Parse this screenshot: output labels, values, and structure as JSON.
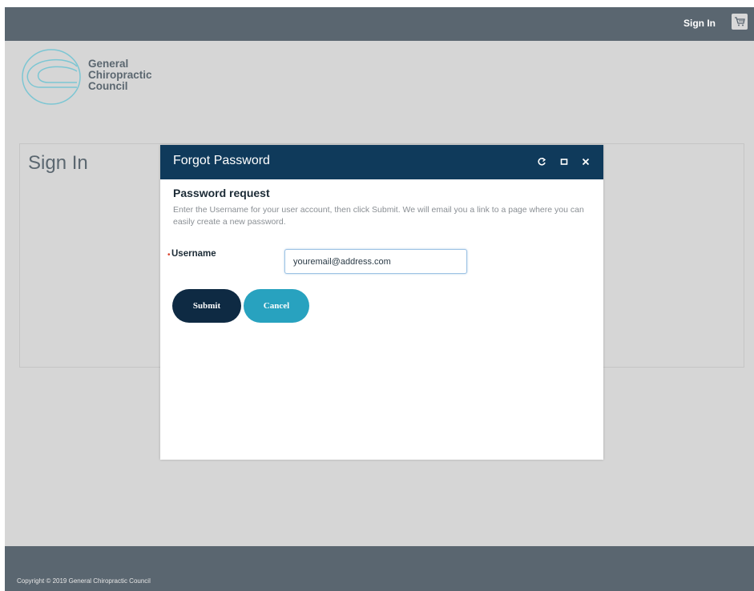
{
  "header": {
    "signin_label": "Sign In",
    "cart_icon": "cart-icon"
  },
  "logo": {
    "line1": "General",
    "line2": "Chiropractic",
    "line3": "Council"
  },
  "page": {
    "title": "Sign In"
  },
  "modal": {
    "title": "Forgot Password",
    "heading": "Password request",
    "description": "Enter the Username for your user account, then click Submit. We will email you a link to a page where you can easily create a new password.",
    "required_mark": "•",
    "username_label": "Username",
    "username_value": "youremail@address.com",
    "submit_label": "Submit",
    "cancel_label": "Cancel",
    "icons": [
      "refresh-icon",
      "maximize-icon",
      "close-icon"
    ]
  },
  "footer": {
    "copyright": "Copyright © 2019 General Chiropractic Council"
  },
  "colors": {
    "topbar": "#5a6670",
    "modal_header": "#0f3a5b",
    "submit": "#0e2a43",
    "cancel": "#28a2bf",
    "logo_teal": "#7cc6d3"
  }
}
